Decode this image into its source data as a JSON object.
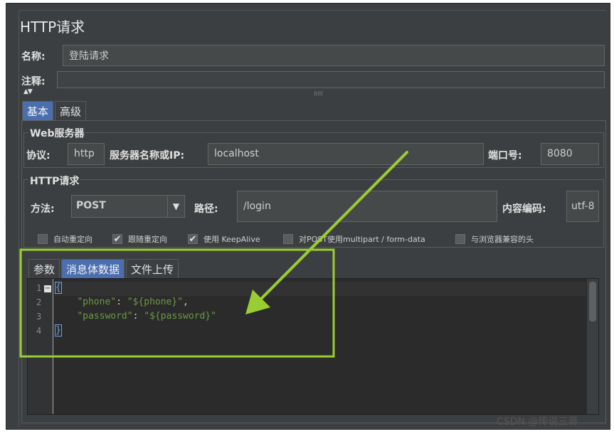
{
  "panel": {
    "title": "HTTP请求"
  },
  "name_row": {
    "label": "名称:",
    "value": "登陆请求"
  },
  "comment_row": {
    "label": "注释:",
    "value": ""
  },
  "tabs": [
    {
      "label": "基本",
      "active": true
    },
    {
      "label": "高级",
      "active": false
    }
  ],
  "web_server": {
    "group_title": "Web服务器",
    "protocol_label": "协议:",
    "protocol_value": "http",
    "server_label": "服务器名称或IP:",
    "server_value": "localhost",
    "port_label": "端口号:",
    "port_value": "8080"
  },
  "http_request": {
    "group_title": "HTTP请求",
    "method_label": "方法:",
    "method_value": "POST",
    "path_label": "路径:",
    "path_value": "/login",
    "encoding_label": "内容编码:",
    "encoding_value": "utf-8"
  },
  "checkboxes": [
    {
      "label": "自动重定向",
      "checked": false
    },
    {
      "label": "跟随重定向",
      "checked": true
    },
    {
      "label": "使用 KeepAlive",
      "checked": true
    },
    {
      "label": "对POST使用multipart / form-data",
      "checked": false
    },
    {
      "label": "与浏览器兼容的头",
      "checked": false
    }
  ],
  "body_tabs": [
    {
      "label": "参数",
      "active": false
    },
    {
      "label": "消息体数据",
      "active": true
    },
    {
      "label": "文件上传",
      "active": false
    }
  ],
  "editor": {
    "line_numbers": [
      "1",
      "2",
      "3",
      "4"
    ],
    "line1": "{",
    "line2_key": "\"phone\"",
    "line2_sep": ": ",
    "line2_val": "\"${phone}\"",
    "line2_comma": ",",
    "line3_key": "\"password\"",
    "line3_sep": ": ",
    "line3_val": "\"${password}\"",
    "line4": "}"
  },
  "annotation": {
    "color": "#9acd32"
  },
  "watermark": "CSDN @传说三哥"
}
